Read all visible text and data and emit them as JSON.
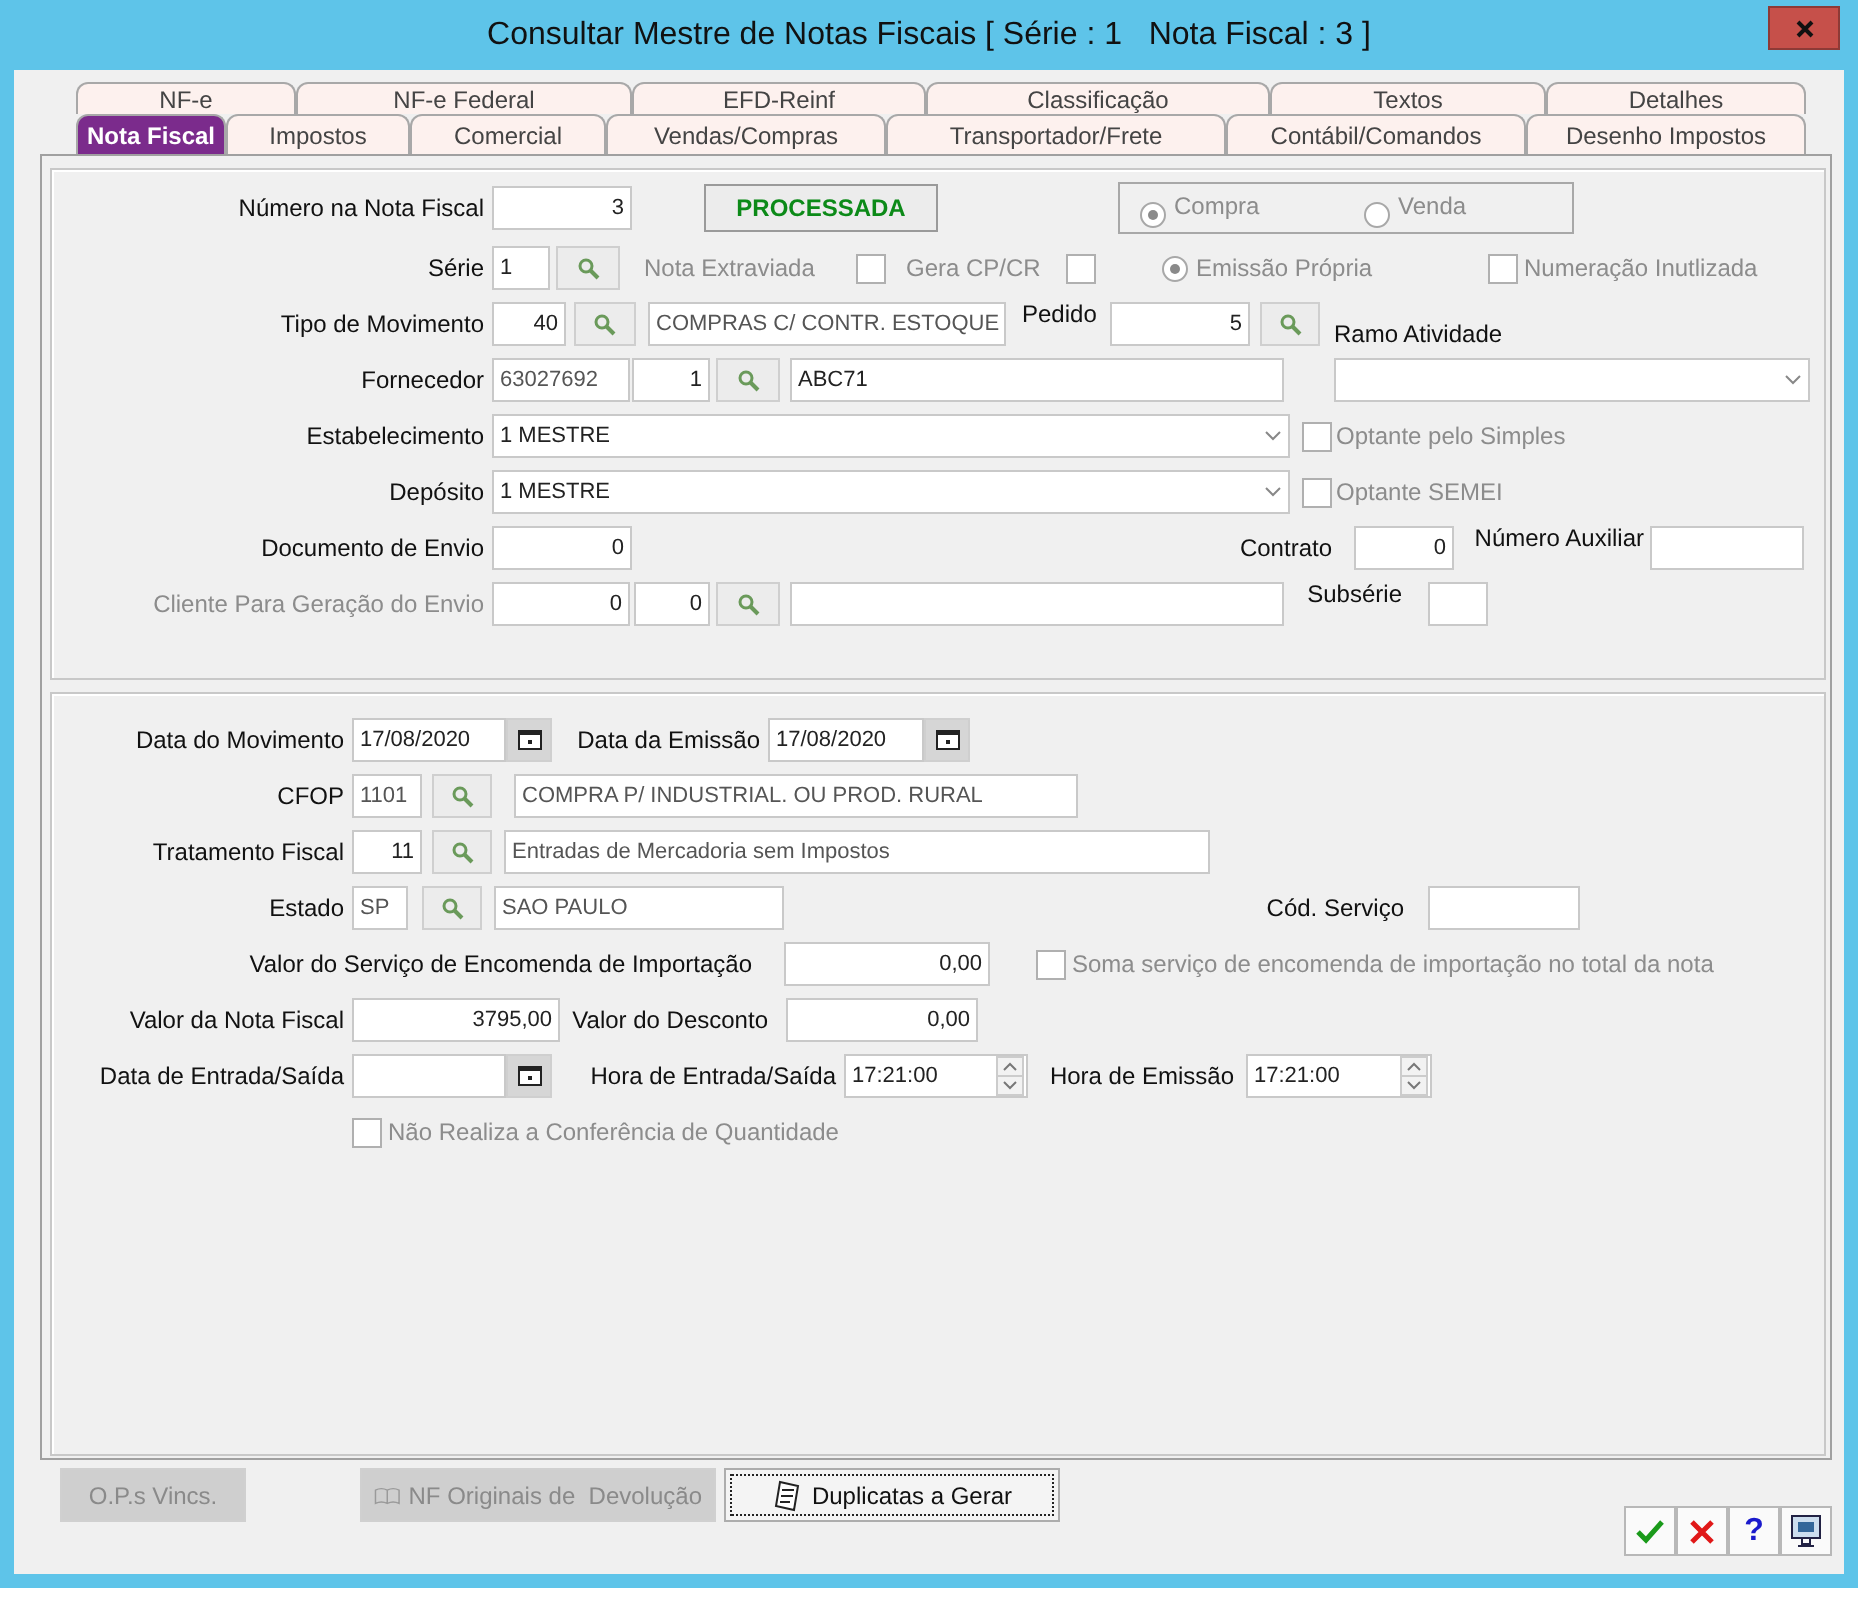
{
  "window": {
    "title": "Consultar Mestre de Notas Fiscais [ Série : 1   Nota Fiscal : 3 ]"
  },
  "tabs_back": [
    {
      "label": "NF-e",
      "selected": false
    },
    {
      "label": "NF-e Federal",
      "selected": false
    },
    {
      "label": "EFD-Reinf",
      "selected": false
    },
    {
      "label": "Classificação",
      "selected": false
    },
    {
      "label": "Textos",
      "selected": false
    },
    {
      "label": "Detalhes",
      "selected": false
    }
  ],
  "tabs_front": [
    {
      "label": "Nota Fiscal",
      "selected": true
    },
    {
      "label": "Impostos",
      "selected": false
    },
    {
      "label": "Comercial",
      "selected": false
    },
    {
      "label": "Vendas/Compras",
      "selected": false
    },
    {
      "label": "Transportador/Frete",
      "selected": false
    },
    {
      "label": "Contábil/Comandos",
      "selected": false
    },
    {
      "label": "Desenho Impostos",
      "selected": false
    }
  ],
  "header": {
    "numero": {
      "label": "Número na Nota Fiscal",
      "value": "3"
    },
    "status": "PROCESSADA",
    "operacao": [
      {
        "label": "Compra",
        "selected": true
      },
      {
        "label": "Venda",
        "selected": false
      }
    ],
    "serie": {
      "label": "Série",
      "value": "1"
    },
    "nota_extraviada": {
      "label": "Nota Extraviada",
      "checked": false,
      "disabled": true
    },
    "gera_cp_cr": {
      "label": "Gera CP/CR",
      "checked": false,
      "disabled": true
    },
    "emissao_propria": {
      "label": "Emissão Própria",
      "selected": true
    },
    "numeracao_inutilizada": {
      "label": "Numeração Inutlizada",
      "checked": false,
      "disabled": true
    },
    "tipo_movimento": {
      "label": "Tipo de Movimento",
      "code": "40",
      "description": "COMPRAS C/ CONTR. ESTOQUE"
    },
    "pedido": {
      "label": "Pedido",
      "value": "5"
    },
    "ramo_atividade": {
      "label": "Ramo Atividade"
    },
    "fornecedor": {
      "label": "Fornecedor",
      "code": "63027692",
      "branch": "1",
      "name": "ABC71"
    },
    "estabelecimento": {
      "label": "Estabelecimento",
      "value": "1 MESTRE"
    },
    "optante_simples": {
      "label": "Optante pelo Simples",
      "checked": false,
      "disabled": true
    },
    "deposito": {
      "label": "Depósito",
      "value": "1 MESTRE"
    },
    "optante_semei": {
      "label": "Optante SEMEI",
      "checked": false,
      "disabled": true
    },
    "documento_envio": {
      "label": "Documento de Envio",
      "value": "0"
    },
    "contrato": {
      "label": "Contrato",
      "value": "0"
    },
    "numero_auxiliar": {
      "label": "Número Auxiliar"
    },
    "cliente_envio": {
      "label": "Cliente Para Geração do Envio",
      "disabled": true,
      "code": "0",
      "branch": "0"
    },
    "subserie": {
      "label": "Subsérie"
    }
  },
  "details": {
    "data_movimento": {
      "label": "Data do Movimento",
      "value": "17/08/2020"
    },
    "data_emissao": {
      "label": "Data da Emissão",
      "value": "17/08/2020"
    },
    "cfop": {
      "label": "CFOP",
      "code": "1101",
      "description": "COMPRA P/ INDUSTRIAL. OU PROD. RURAL"
    },
    "tratamento_fiscal": {
      "label": "Tratamento Fiscal",
      "code": "11",
      "description": "Entradas de Mercadoria sem Impostos"
    },
    "estado": {
      "label": "Estado",
      "code": "SP",
      "description": "SAO PAULO"
    },
    "cod_servico": {
      "label": "Cód. Serviço"
    },
    "valor_servico_importacao": {
      "label": "Valor do Serviço de Encomenda de Importação",
      "value": "0,00"
    },
    "soma_servico": {
      "label": "Soma serviço de encomenda de importação no total da nota",
      "checked": false,
      "disabled": true
    },
    "valor_nota": {
      "label": "Valor da Nota Fiscal",
      "value": "3795,00"
    },
    "valor_desconto": {
      "label": "Valor do Desconto",
      "value": "0,00"
    },
    "data_entrada_saida": {
      "label": "Data de Entrada/Saída"
    },
    "hora_entrada_saida": {
      "label": "Hora de Entrada/Saída",
      "value": "17:21:00"
    },
    "hora_emissao": {
      "label": "Hora de Emissão",
      "value": "17:21:00"
    },
    "nao_realiza_conferencia": {
      "label": "Não Realiza a Conferência de Quantidade",
      "checked": false,
      "disabled": true
    }
  },
  "buttons": [
    {
      "label": "O.P.s Vincs.",
      "disabled": true,
      "focused": false
    },
    {
      "label": "NF Originais de  Devolução",
      "disabled": true,
      "focused": false
    },
    {
      "label": "Duplicatas a Gerar",
      "disabled": false,
      "focused": true
    }
  ],
  "actions": [
    {
      "kind": "confirm"
    },
    {
      "kind": "cancel"
    },
    {
      "kind": "help",
      "label": "?"
    },
    {
      "kind": "screen"
    }
  ]
}
